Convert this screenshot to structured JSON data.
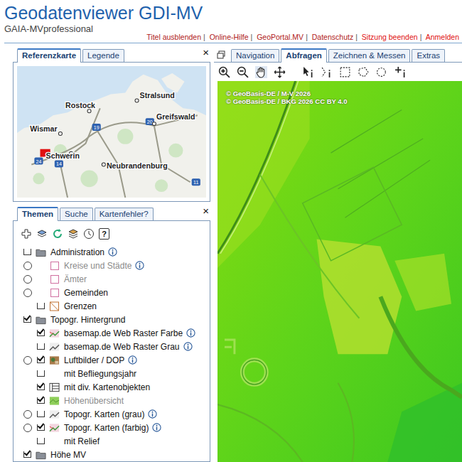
{
  "header": {
    "title": "Geodatenviewer GDI-MV",
    "subtitle": "GAIA-MVprofessional",
    "separator": "|",
    "links": [
      {
        "label": "Titel ausblenden",
        "color": "#b02020"
      },
      {
        "label": "Online-Hilfe",
        "color": "#b02020"
      },
      {
        "label": "GeoPortal.MV",
        "color": "#b02020"
      },
      {
        "label": "Datenschutz",
        "color": "#b02020"
      },
      {
        "label": "Sitzung beenden",
        "color": "#e01010"
      },
      {
        "label": "Anmelden",
        "color": "#e01010"
      }
    ]
  },
  "reference_panel": {
    "tabs": [
      {
        "label": "Referenzkarte",
        "selected": true
      },
      {
        "label": "Legende",
        "selected": false
      }
    ],
    "close": "×",
    "cities": [
      "Stralsund",
      "Rostock",
      "Greifswald",
      "Wismar",
      "Schwerin",
      "Neubrandenburg"
    ],
    "roads": [
      "19",
      "20",
      "24",
      "14",
      "11"
    ]
  },
  "themes_panel": {
    "tabs": [
      {
        "label": "Themen",
        "selected": true
      },
      {
        "label": "Suche",
        "selected": false
      },
      {
        "label": "Kartenfehler?",
        "selected": false
      }
    ],
    "close": "×",
    "help": "?",
    "items": [
      {
        "label": "Administration",
        "kind": "folder",
        "radio": false,
        "checkbox": true,
        "checked": false,
        "greyed": false,
        "info": true
      },
      {
        "label": "Kreise und Städte",
        "kind": "area",
        "radio": true,
        "checkbox": false,
        "checked": false,
        "greyed": true,
        "info": true
      },
      {
        "label": "Ämter",
        "kind": "area",
        "radio": true,
        "checkbox": false,
        "checked": false,
        "greyed": true,
        "info": false
      },
      {
        "label": "Gemeinden",
        "kind": "area",
        "radio": true,
        "checkbox": false,
        "checked": false,
        "greyed": false,
        "info": false
      },
      {
        "label": "Grenzen",
        "kind": "boundary",
        "radio": false,
        "checkbox": true,
        "checked": false,
        "greyed": false,
        "info": false
      },
      {
        "label": "Topogr. Hintergrund",
        "kind": "folder",
        "radio": false,
        "checkbox": true,
        "checked": true,
        "greyed": false,
        "info": false
      },
      {
        "label": "basemap.de Web Raster Farbe",
        "kind": "raster",
        "radio": false,
        "checkbox": true,
        "checked": true,
        "greyed": false,
        "info": true
      },
      {
        "label": "basemap.de Web Raster Grau",
        "kind": "raster_grey",
        "radio": false,
        "checkbox": true,
        "checked": false,
        "greyed": false,
        "info": true
      },
      {
        "label": "Luftbilder / DOP",
        "kind": "photo",
        "radio": true,
        "checkbox": true,
        "checked": true,
        "greyed": false,
        "info": true
      },
      {
        "label": "mit Befliegungsjahr",
        "kind": "none",
        "radio": false,
        "checkbox": true,
        "checked": false,
        "greyed": false,
        "info": false
      },
      {
        "label": "mit div. Kartenobjekten",
        "kind": "objects",
        "radio": false,
        "checkbox": true,
        "checked": true,
        "greyed": false,
        "info": false
      },
      {
        "label": "Höhenübersicht",
        "kind": "relief",
        "radio": false,
        "checkbox": true,
        "checked": true,
        "greyed": true,
        "info": false
      },
      {
        "label": "Topogr. Karten (grau)",
        "kind": "raster_grey",
        "radio": true,
        "checkbox": true,
        "checked": false,
        "greyed": false,
        "info": true
      },
      {
        "label": "Topogr. Karten (farbig)",
        "kind": "raster",
        "radio": true,
        "checkbox": true,
        "checked": true,
        "greyed": false,
        "info": true
      },
      {
        "label": "mit Relief",
        "kind": "none",
        "radio": false,
        "checkbox": true,
        "checked": false,
        "greyed": false,
        "info": false
      },
      {
        "label": "Höhe MV",
        "kind": "folder",
        "radio": false,
        "checkbox": true,
        "checked": true,
        "greyed": false,
        "info": false
      }
    ]
  },
  "map_panel": {
    "tabs": [
      {
        "label": "Navigation",
        "selected": false
      },
      {
        "label": "Abfragen",
        "selected": true
      },
      {
        "label": "Zeichnen & Messen",
        "selected": false
      },
      {
        "label": "Extras",
        "selected": false
      }
    ],
    "copyright": [
      "© GeoBasis-DE / M-V 2026",
      "© GeoBasis-DE / BKG 2026 CC BY 4.0"
    ]
  }
}
